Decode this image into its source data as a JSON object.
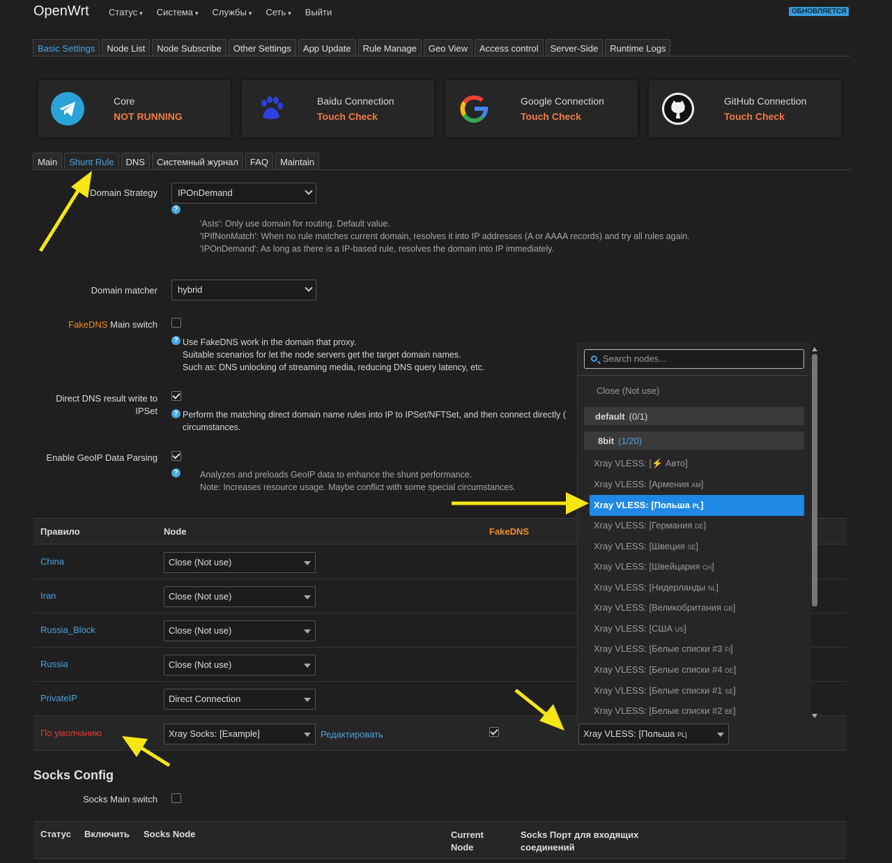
{
  "app": {
    "brand": "OpenWrt",
    "update_badge": "ОБНОВЛЯЕТСЯ"
  },
  "menu": [
    "Статус",
    "Система",
    "Службы",
    "Сеть",
    "Выйти"
  ],
  "main_tabs": [
    "Basic Settings",
    "Node List",
    "Node Subscribe",
    "Other Settings",
    "App Update",
    "Rule Manage",
    "Geo View",
    "Access control",
    "Server-Side",
    "Runtime Logs"
  ],
  "cards": [
    {
      "title": "Core",
      "status": "NOT RUNNING",
      "icon": "telegram-icon"
    },
    {
      "title": "Baidu Connection",
      "status": "Touch Check",
      "icon": "baidu-paw-icon"
    },
    {
      "title": "Google Connection",
      "status": "Touch Check",
      "icon": "google-icon"
    },
    {
      "title": "GitHub Connection",
      "status": "Touch Check",
      "icon": "github-icon"
    }
  ],
  "sub_tabs": [
    "Main",
    "Shunt Rule",
    "DNS",
    "Системный журнал",
    "FAQ",
    "Maintain"
  ],
  "form": {
    "domain_strategy": {
      "label": "Domain Strategy",
      "value": "IPOnDemand",
      "desc": [
        "'AsIs': Only use domain for routing. Default value.",
        "'IPIfNonMatch': When no rule matches current domain, resolves it into IP addresses (A or AAAA records) and try all rules again.",
        "'IPOnDemand': As long as there is a IP-based rule, resolves the domain into IP immediately."
      ]
    },
    "domain_matcher": {
      "label": "Domain matcher",
      "value": "hybrid"
    },
    "fakedns": {
      "label_hl": "FakeDNS",
      "label_rest": " Main switch",
      "desc": [
        "Use FakeDNS work in the domain that proxy.",
        "Suitable scenarios for let the node servers get the target domain names.",
        "Such as: DNS unlocking of streaming media, reducing DNS query latency, etc."
      ]
    },
    "direct_dns": {
      "label1": "Direct DNS result write to",
      "label2": "IPSet",
      "desc": [
        "Perform the matching direct domain name rules into IP to IPSet/NFTSet, and then connect directly (",
        "circumstances."
      ]
    },
    "geoip": {
      "label": "Enable GeoIP Data Parsing",
      "desc": [
        "Analyzes and preloads GeoIP data to enhance the shunt performance.",
        "Note: Increases resource usage. Maybe conflict with some special circumstances."
      ]
    }
  },
  "table": {
    "headers": {
      "rule": "Правило",
      "node": "Node",
      "fakedns": "FakeDNS"
    },
    "rows": [
      {
        "name": "China",
        "node": "Close (Not use)"
      },
      {
        "name": "Iran",
        "node": "Close (Not use)"
      },
      {
        "name": "Russia_Block",
        "node": "Close (Not use)"
      },
      {
        "name": "Russia",
        "node": "Close (Not use)"
      },
      {
        "name": "PrivateIP",
        "node": "Direct Connection"
      }
    ],
    "default_row": {
      "name": "По умолчанию",
      "node": "Xray Socks:  [Example]",
      "edit": "Редактировать",
      "fallback": "Xray VLESS:  [Польша",
      "fallback_cc": "PL]"
    }
  },
  "dropdown": {
    "search_placeholder": "Search nodes...",
    "close_option": "Close (Not use)",
    "group_default": {
      "name": "default",
      "count": "(0/1)"
    },
    "group_8bit": {
      "name": "8bit",
      "count": "(1/20)"
    },
    "options": [
      {
        "label": "Xray VLESS:  [",
        "cc": "",
        "tail": "Авто]",
        "bolt": true
      },
      {
        "label": "Xray VLESS:  [Армения ",
        "cc": "AM",
        "tail": "]"
      },
      {
        "label": "Xray VLESS:  [Польша ",
        "cc": "PL",
        "tail": "]",
        "selected": true
      },
      {
        "label": "Xray VLESS:  [Германия ",
        "cc": "DE",
        "tail": "]"
      },
      {
        "label": "Xray VLESS:  [Швеция ",
        "cc": "SE",
        "tail": "]"
      },
      {
        "label": "Xray VLESS:  [Швейцария ",
        "cc": "CH",
        "tail": "]"
      },
      {
        "label": "Xray VLESS:  [Нидерланды ",
        "cc": "NL",
        "tail": "]"
      },
      {
        "label": "Xray VLESS:  [Великобритания ",
        "cc": "GB",
        "tail": "]"
      },
      {
        "label": "Xray VLESS:  [США ",
        "cc": "US",
        "tail": "]"
      },
      {
        "label": "Xray VLESS:  [Белые списки #3 ",
        "cc": "FI",
        "tail": "]"
      },
      {
        "label": "Xray VLESS:  [Белые списки #4 ",
        "cc": "DE",
        "tail": "]"
      },
      {
        "label": "Xray VLESS:  [Белые списки #1 ",
        "cc": "SE",
        "tail": "]"
      },
      {
        "label": "Xray VLESS:  [Белые списки #2 ",
        "cc": "BE",
        "tail": "]"
      }
    ]
  },
  "socks": {
    "title": "Socks Config",
    "switch_label": "Socks Main switch",
    "headers": {
      "status": "Статус",
      "enable": "Включить",
      "node": "Socks Node",
      "current1": "Current",
      "current2": "Node",
      "port1": "Socks Порт для входящих",
      "port2": "соединений"
    }
  },
  "colors": {
    "accent": "#4aa3df",
    "warn": "#f07c48",
    "danger": "#e53935",
    "highlight": "#1e88e5",
    "annotation": "#f5e614"
  }
}
